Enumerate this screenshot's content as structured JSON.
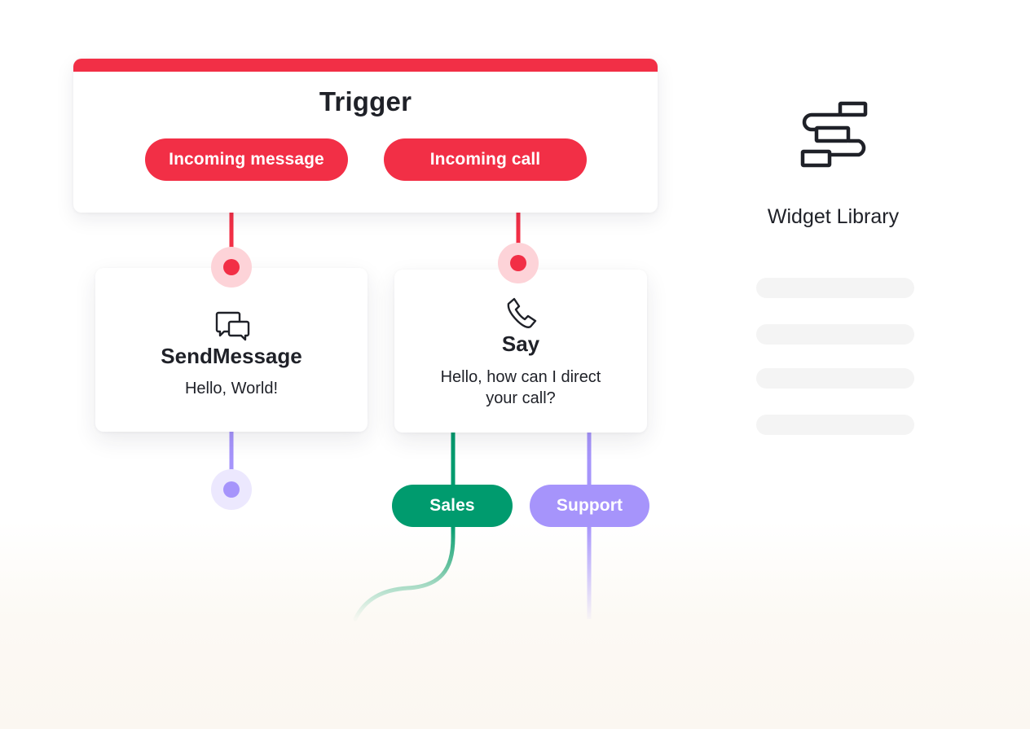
{
  "colors": {
    "red": "#f22f46",
    "red_halo": "#fdd3d8",
    "green": "#009b6e",
    "purple": "#a694fb",
    "purple_halo": "#ece8fe",
    "text": "#1f2128",
    "skeleton": "#f4f4f4"
  },
  "trigger": {
    "title": "Trigger",
    "options": [
      {
        "label": "Incoming message"
      },
      {
        "label": "Incoming call"
      }
    ]
  },
  "nodes": [
    {
      "icon": "chat-bubbles-icon",
      "title": "SendMessage",
      "text": "Hello, World!"
    },
    {
      "icon": "phone-icon",
      "title": "Say",
      "text": "Hello, how can I direct your call?"
    }
  ],
  "branches": [
    {
      "label": "Sales"
    },
    {
      "label": "Support"
    }
  ],
  "widget_library": {
    "icon": "widget-library-icon",
    "title": "Widget Library",
    "placeholder_items": 4
  }
}
